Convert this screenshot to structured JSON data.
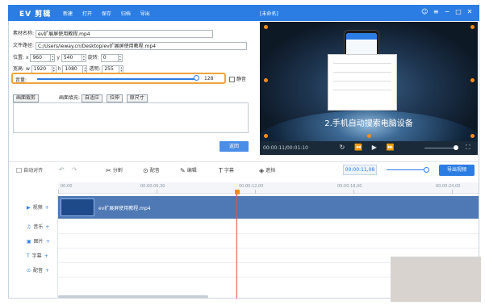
{
  "app": {
    "logo": "EV 剪辑",
    "title": "[未命名]",
    "menu": [
      "新建",
      "打开",
      "保存",
      "归档",
      "导出"
    ],
    "window_icons": [
      "user-icon",
      "settings-icon",
      "minimize-icon",
      "maximize-icon",
      "close-icon"
    ]
  },
  "props": {
    "material_name_label": "素材名称:",
    "material_name": "ev扩展屏使用教程.mp4",
    "file_path_label": "文件路径:",
    "file_path": "C:/Users/ieway.cn/Desktop/ev扩展屏使用教程.mp4",
    "position_label": "位置:",
    "x_label": "x",
    "x_value": "960",
    "y_label": "y",
    "y_value": "540",
    "rotate_label": "旋转:",
    "rotate_value": "0",
    "size_label": "宽高:",
    "w_label": "w",
    "w_value": "1920",
    "h_label": "h",
    "h_value": "1080",
    "opacity_label": "透明:",
    "opacity_value": "255",
    "volume_label": "音量:",
    "volume_value": "128",
    "volume_level_fraction": 0.98,
    "mute_label": "静音",
    "crop_button": "画面裁剪",
    "fill_label": "画面填充:",
    "fill_options": [
      "自适应",
      "拉伸",
      "原尺寸"
    ],
    "return_button": "返回"
  },
  "preview": {
    "caption": "2.手机自动搜索电脑设备",
    "time": "00:00:11/00:01:10",
    "volume_level_fraction": 0.9
  },
  "toolbar": {
    "auto_align": "自动对齐",
    "split": "分割",
    "voiceover": "配音",
    "edit": "编辑",
    "subtitle": "字幕",
    "watermark": "遮挡",
    "timecode": "00:00:11,08",
    "export": "导出视频"
  },
  "ruler": {
    "ticks": [
      "00:00",
      "00:00:06,30",
      "00:00:12,00",
      "00:00:18,00",
      "00:00:24,00"
    ]
  },
  "tracks": [
    {
      "name": "视频",
      "icon": "video-icon"
    },
    {
      "name": "音乐",
      "icon": "music-icon"
    },
    {
      "name": "图片",
      "icon": "image-icon"
    },
    {
      "name": "字幕",
      "icon": "text-icon"
    },
    {
      "name": "配音",
      "icon": "mic-icon"
    }
  ],
  "clip": {
    "name": "ev扩展屏使用教程.mp4"
  },
  "colors": {
    "accent": "#2b7de4",
    "highlight": "#f0a43a",
    "playhead": "#e05252"
  }
}
